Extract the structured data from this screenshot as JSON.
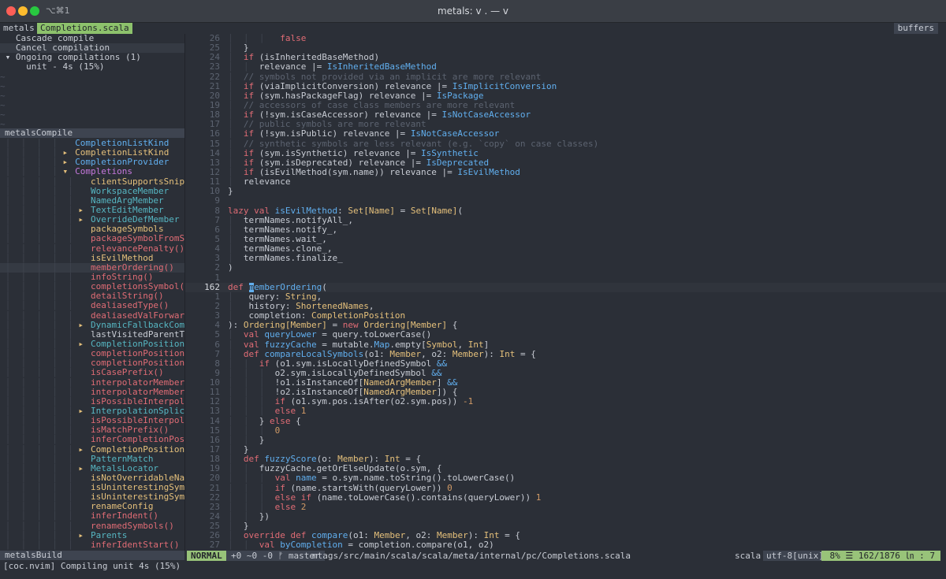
{
  "window": {
    "tab_shortcut": "⌥⌘1",
    "title": "metals: v . — v"
  },
  "tabline": {
    "label": "metals",
    "file": "Completions.scala",
    "buffers": "buffers"
  },
  "commands": {
    "items": [
      "Cascade compile",
      "Cancel compilation",
      "Ongoing compilations (1)",
      "unit - 4s (15%)"
    ],
    "tilde_rows": 6
  },
  "windows": {
    "compile_title": "metalsCompile",
    "build_title": "metalsBuild"
  },
  "tree": [
    {
      "arrow": "",
      "label": "CompletionListKind",
      "color": "#61afef",
      "depth": 1
    },
    {
      "arrow": "▸",
      "label": "CompletionListKind",
      "color": "#e5c07b",
      "depth": 1
    },
    {
      "arrow": "▸",
      "label": "CompletionProvider",
      "color": "#61afef",
      "depth": 1
    },
    {
      "arrow": "▾",
      "label": "Completions",
      "color": "#c678dd",
      "depth": 1
    },
    {
      "arrow": "",
      "label": "clientSupportsSnippets",
      "color": "#e5c07b",
      "depth": 2
    },
    {
      "arrow": "",
      "label": "WorkspaceMember",
      "color": "#56b6c2",
      "depth": 2
    },
    {
      "arrow": "",
      "label": "NamedArgMember",
      "color": "#56b6c2",
      "depth": 2
    },
    {
      "arrow": "▸",
      "label": "TextEditMember",
      "color": "#56b6c2",
      "depth": 2
    },
    {
      "arrow": "▸",
      "label": "OverrideDefMember",
      "color": "#56b6c2",
      "depth": 2
    },
    {
      "arrow": "",
      "label": "packageSymbols",
      "color": "#e5c07b",
      "depth": 2
    },
    {
      "arrow": "",
      "label": "packageSymbolFromStrin",
      "color": "#e06c75",
      "depth": 2
    },
    {
      "arrow": "",
      "label": "relevancePenalty()",
      "color": "#e06c75",
      "depth": 2
    },
    {
      "arrow": "",
      "label": "isEvilMethod",
      "color": "#e5c07b",
      "depth": 2
    },
    {
      "arrow": "",
      "label": "memberOrdering()",
      "color": "#e06c75",
      "depth": 2,
      "current": true
    },
    {
      "arrow": "",
      "label": "infoString()",
      "color": "#e06c75",
      "depth": 2
    },
    {
      "arrow": "",
      "label": "completionsSymbol()",
      "color": "#e06c75",
      "depth": 2
    },
    {
      "arrow": "",
      "label": "detailString()",
      "color": "#e06c75",
      "depth": 2
    },
    {
      "arrow": "",
      "label": "dealiasedType()",
      "color": "#e06c75",
      "depth": 2
    },
    {
      "arrow": "",
      "label": "dealiasedValForwarder(",
      "color": "#e06c75",
      "depth": 2
    },
    {
      "arrow": "▸",
      "label": "DynamicFallbackComplet",
      "color": "#56b6c2",
      "depth": 2
    },
    {
      "arrow": "",
      "label": "lastVisitedParentTree",
      "color": "#c8ccd4",
      "depth": 2
    },
    {
      "arrow": "▸",
      "label": "CompletionPosition",
      "color": "#56b6c2",
      "depth": 2
    },
    {
      "arrow": "",
      "label": "completionPosition()",
      "color": "#e06c75",
      "depth": 2
    },
    {
      "arrow": "",
      "label": "completionPositionUnsa",
      "color": "#e06c75",
      "depth": 2
    },
    {
      "arrow": "",
      "label": "isCasePrefix()",
      "color": "#e06c75",
      "depth": 2
    },
    {
      "arrow": "",
      "label": "interpolatorMemberArg(",
      "color": "#e06c75",
      "depth": 2
    },
    {
      "arrow": "",
      "label": "interpolatorMemberSele",
      "color": "#e06c75",
      "depth": 2
    },
    {
      "arrow": "",
      "label": "isPossibleInterpolator",
      "color": "#e06c75",
      "depth": 2
    },
    {
      "arrow": "▸",
      "label": "InterpolationSplice",
      "color": "#56b6c2",
      "depth": 2
    },
    {
      "arrow": "",
      "label": "isPossibleInterpolator",
      "color": "#e06c75",
      "depth": 2
    },
    {
      "arrow": "",
      "label": "isMatchPrefix()",
      "color": "#e06c75",
      "depth": 2
    },
    {
      "arrow": "",
      "label": "inferCompletionPositio",
      "color": "#e06c75",
      "depth": 2
    },
    {
      "arrow": "▸",
      "label": "CompletionPosition",
      "color": "#e5c07b",
      "depth": 2
    },
    {
      "arrow": "",
      "label": "PatternMatch",
      "color": "#56b6c2",
      "depth": 2
    },
    {
      "arrow": "▸",
      "label": "MetalsLocator",
      "color": "#56b6c2",
      "depth": 2
    },
    {
      "arrow": "",
      "label": "isNotOverridableName",
      "color": "#e5c07b",
      "depth": 2
    },
    {
      "arrow": "",
      "label": "isUninterestingSymbolO",
      "color": "#e5c07b",
      "depth": 2
    },
    {
      "arrow": "",
      "label": "isUninterestingSymbol",
      "color": "#e5c07b",
      "depth": 2
    },
    {
      "arrow": "",
      "label": "renameConfig",
      "color": "#e5c07b",
      "depth": 2
    },
    {
      "arrow": "",
      "label": "inferIndent()",
      "color": "#e06c75",
      "depth": 2
    },
    {
      "arrow": "",
      "label": "renamedSymbols()",
      "color": "#e06c75",
      "depth": 2
    },
    {
      "arrow": "▸",
      "label": "Parents",
      "color": "#56b6c2",
      "depth": 2
    },
    {
      "arrow": "",
      "label": "inferIdentStart()",
      "color": "#e06c75",
      "depth": 2
    }
  ],
  "editor": {
    "lines": [
      {
        "n": "26",
        "html": "<span class='guide'>│  │  │ </span>  <span class='k'>false</span>"
      },
      {
        "n": "25",
        "html": "<span class='guide'>│ </span> }"
      },
      {
        "n": "24",
        "html": "<span class='guide'>│ </span> <span class='k'>if</span> (isInheritedBaseMethod)"
      },
      {
        "n": "23",
        "html": "<span class='guide'>│  │ </span> relevance |= <span class='f'>IsInheritedBaseMethod</span>"
      },
      {
        "n": "22",
        "html": "<span class='guide'>│ </span> <span class='c'>// symbols not provided via an implicit are more relevant</span>"
      },
      {
        "n": "21",
        "html": "<span class='guide'>│ </span> <span class='k'>if</span> (viaImplicitConversion) relevance |= <span class='f'>IsImplicitConversion</span>"
      },
      {
        "n": "20",
        "html": "<span class='guide'>│ </span> <span class='k'>if</span> (sym.hasPackageFlag) relevance |= <span class='f'>IsPackage</span>"
      },
      {
        "n": "19",
        "html": "<span class='guide'>│ </span> <span class='c'>// accessors of case class members are more relevant</span>"
      },
      {
        "n": "18",
        "html": "<span class='guide'>│ </span> <span class='k'>if</span> (!sym.isCaseAccessor) relevance |= <span class='f'>IsNotCaseAccessor</span>"
      },
      {
        "n": "17",
        "html": "<span class='guide'>│ </span> <span class='c'>// public symbols are more relevant</span>"
      },
      {
        "n": "16",
        "html": "<span class='guide'>│ </span> <span class='k'>if</span> (!sym.isPublic) relevance |= <span class='f'>IsNotCaseAccessor</span>"
      },
      {
        "n": "15",
        "html": "<span class='guide'>│ </span> <span class='c'>// synthetic symbols are less relevant (e.g. `copy` on case classes)</span>"
      },
      {
        "n": "14",
        "html": "<span class='guide'>│ </span> <span class='k'>if</span> (sym.isSynthetic) relevance |= <span class='f'>IsSynthetic</span>"
      },
      {
        "n": "13",
        "html": "<span class='guide'>│ </span> <span class='k'>if</span> (sym.isDeprecated) relevance |= <span class='f'>IsDeprecated</span>"
      },
      {
        "n": "12",
        "html": "<span class='guide'>│ </span> <span class='k'>if</span> (isEvilMethod(sym.name)) relevance |= <span class='f'>IsEvilMethod</span>"
      },
      {
        "n": "11",
        "html": "<span class='guide'>│ </span> relevance"
      },
      {
        "n": "10",
        "html": "}"
      },
      {
        "n": "9",
        "html": ""
      },
      {
        "n": "8",
        "html": "<span class='k'>lazy val</span> <span class='f'>isEvilMethod</span>: <span class='t'>Set[Name]</span> = <span class='t'>Set[Name]</span>("
      },
      {
        "n": "7",
        "html": "<span class='guide'>│ </span> termNames.notifyAll_,"
      },
      {
        "n": "6",
        "html": "<span class='guide'>│ </span> termNames.notify_,"
      },
      {
        "n": "5",
        "html": "<span class='guide'>│ </span> termNames.wait_,"
      },
      {
        "n": "4",
        "html": "<span class='guide'>│ </span> termNames.clone_,"
      },
      {
        "n": "3",
        "html": "<span class='guide'>│ </span> termNames.finalize_"
      },
      {
        "n": "2",
        "html": ")"
      },
      {
        "n": "1",
        "html": ""
      },
      {
        "n": "162",
        "cur": true,
        "html": "<span class='k'>def</span> <span class='cursor'>m</span><span class='f'>emberOrdering</span>("
      },
      {
        "n": "1",
        "html": "<span class='guide'>│ </span>  query: <span class='t'>String</span>,"
      },
      {
        "n": "2",
        "html": "<span class='guide'>│ </span>  history: <span class='t'>ShortenedNames</span>,"
      },
      {
        "n": "3",
        "html": "<span class='guide'>│ </span>  completion: <span class='t'>CompletionPosition</span>"
      },
      {
        "n": "4",
        "html": "): <span class='t'>Ordering[Member]</span> = <span class='k'>new</span> <span class='t'>Ordering[Member]</span> {"
      },
      {
        "n": "5",
        "html": "<span class='guide'>│ </span> <span class='k'>val</span> <span class='f'>queryLower</span> = query.toLowerCase()"
      },
      {
        "n": "6",
        "html": "<span class='guide'>│ </span> <span class='k'>val</span> <span class='f'>fuzzyCache</span> = mutable.<span class='f'>Map</span>.empty[<span class='t'>Symbol</span>, <span class='t'>Int</span>]"
      },
      {
        "n": "7",
        "html": "<span class='guide'>│ </span> <span class='k'>def</span> <span class='f'>compareLocalSymbols</span>(o1: <span class='t'>Member</span>, o2: <span class='t'>Member</span>): <span class='t'>Int</span> = {"
      },
      {
        "n": "8",
        "html": "<span class='guide'>│  │ </span> <span class='k'>if</span> (o1.sym.isLocallyDefinedSymbol <span class='f'>&amp;&amp;</span>"
      },
      {
        "n": "9",
        "html": "<span class='guide'>│  │  │ </span> o2.sym.isLocallyDefinedSymbol <span class='f'>&amp;&amp;</span>"
      },
      {
        "n": "10",
        "html": "<span class='guide'>│  │  │ </span> !o1.isInstanceOf[<span class='t'>NamedArgMember</span>] <span class='f'>&amp;&amp;</span>"
      },
      {
        "n": "11",
        "html": "<span class='guide'>│  │  │ </span> !o2.isInstanceOf[<span class='t'>NamedArgMember</span>]) {"
      },
      {
        "n": "12",
        "html": "<span class='guide'>│  │  │ </span> <span class='k'>if</span> (o1.sym.pos.isAfter(o2.sym.pos)) <span class='n'>-1</span>"
      },
      {
        "n": "13",
        "html": "<span class='guide'>│  │  │ </span> <span class='k'>else</span> <span class='n'>1</span>"
      },
      {
        "n": "14",
        "html": "<span class='guide'>│  │ </span> } <span class='k'>else</span> {"
      },
      {
        "n": "15",
        "html": "<span class='guide'>│  │  │ </span> <span class='n'>0</span>"
      },
      {
        "n": "16",
        "html": "<span class='guide'>│  │ </span> }"
      },
      {
        "n": "17",
        "html": "<span class='guide'>│ </span> }"
      },
      {
        "n": "18",
        "html": "<span class='guide'>│ </span> <span class='k'>def</span> <span class='f'>fuzzyScore</span>(o: <span class='t'>Member</span>): <span class='t'>Int</span> = {"
      },
      {
        "n": "19",
        "html": "<span class='guide'>│  │ </span> fuzzyCache.getOrElseUpdate(o.sym, {"
      },
      {
        "n": "20",
        "html": "<span class='guide'>│  │  │ </span> <span class='k'>val</span> <span class='f'>name</span> = o.sym.name.toString().toLowerCase()"
      },
      {
        "n": "21",
        "html": "<span class='guide'>│  │  │ </span> <span class='k'>if</span> (name.startsWith(queryLower)) <span class='n'>0</span>"
      },
      {
        "n": "22",
        "html": "<span class='guide'>│  │  │ </span> <span class='k'>else if</span> (name.toLowerCase().contains(queryLower)) <span class='n'>1</span>"
      },
      {
        "n": "23",
        "html": "<span class='guide'>│  │  │ </span> <span class='k'>else</span> <span class='n'>2</span>"
      },
      {
        "n": "24",
        "html": "<span class='guide'>│  │ </span> })"
      },
      {
        "n": "25",
        "html": "<span class='guide'>│ </span> }"
      },
      {
        "n": "26",
        "html": "<span class='guide'>│ </span> <span class='k'>override def</span> <span class='f'>compare</span>(o1: <span class='t'>Member</span>, o2: <span class='t'>Member</span>): <span class='t'>Int</span> = {"
      },
      {
        "n": "27",
        "html": "<span class='guide'>│  │ </span> <span class='k'>val</span> <span class='f'>byCompletion</span> = completion.compare(o1, o2)"
      }
    ]
  },
  "statusline": {
    "mode": "NORMAL",
    "git": "+0 ~0 -0 ᚠ master",
    "path": "mtags/src/main/scala/scala/meta/internal/pc/Completions.scala",
    "filetype": "scala",
    "encoding": "utf-8[unix]",
    "position": "8% ☰  162/1876 ㏑ :  7"
  },
  "cmdline": "[coc.nvim] Compiling unit 4s (15%)",
  "colors": {
    "accent_green": "#98c379",
    "bg": "#2b2f37"
  }
}
